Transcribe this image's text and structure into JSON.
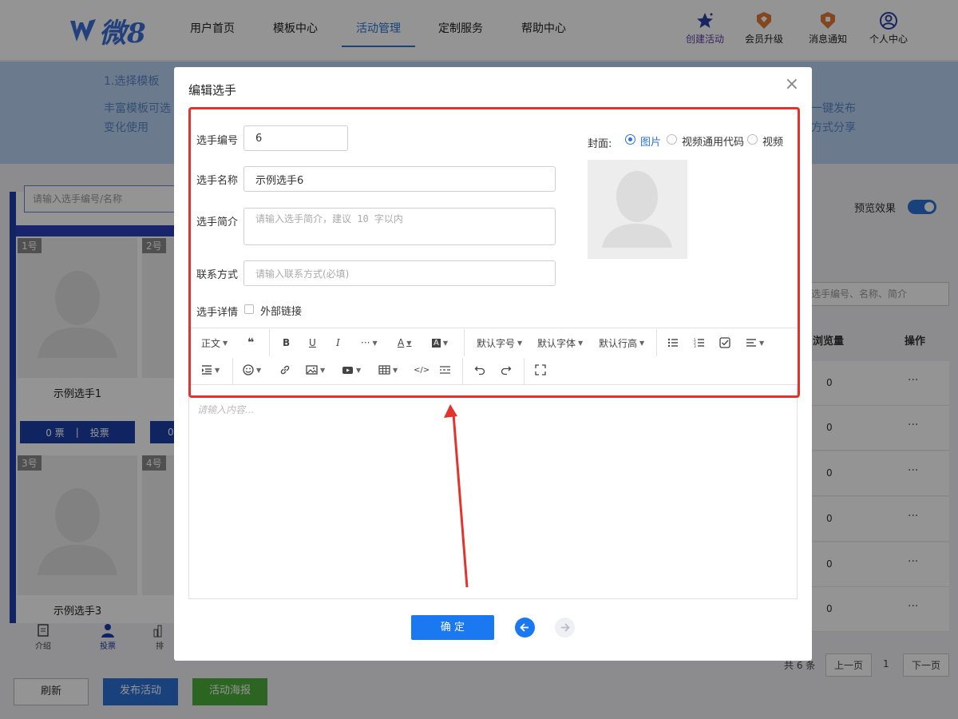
{
  "brand": {
    "logo_text": "微8"
  },
  "nav": {
    "items": [
      {
        "label": "用户首页"
      },
      {
        "label": "模板中心"
      },
      {
        "label": "活动管理"
      },
      {
        "label": "定制服务"
      },
      {
        "label": "帮助中心"
      }
    ],
    "active_index": 2,
    "right": [
      {
        "label": "创建活动",
        "icon": "star-icon"
      },
      {
        "label": "会员升级",
        "icon": "diamond-badge-icon"
      },
      {
        "label": "消息通知",
        "icon": "bell-badge-icon"
      },
      {
        "label": "个人中心",
        "icon": "user-circle-icon"
      }
    ]
  },
  "banner": {
    "left_title": "1.选择模板",
    "left_line1": "丰富模板可选",
    "left_line2": "变化使用",
    "right_line1": "一键发布",
    "right_line2": "方式分享"
  },
  "background": {
    "search_placeholder": "请输入选手编号/名称",
    "players": [
      {
        "no": "1号",
        "name": "示例选手1"
      },
      {
        "no": "2号",
        "name": ""
      },
      {
        "no": "3号",
        "name": "示例选手3"
      },
      {
        "no": "4号",
        "name": ""
      }
    ],
    "vote": {
      "votes": "0 票",
      "action": "投票",
      "partial": "0"
    },
    "tabs": [
      {
        "label": "介绍",
        "icon": "document-icon"
      },
      {
        "label": "投票",
        "icon": "user-icon"
      },
      {
        "label": "排",
        "icon": "bar-chart-icon"
      }
    ],
    "preview_label": "预览效果",
    "right_search_placeholder": "选手编号、名称、简介",
    "table_headers": {
      "views": "浏览量",
      "ops": "操作"
    },
    "rows": [
      {
        "views": "0",
        "ops": "···"
      },
      {
        "views": "0",
        "ops": "···"
      },
      {
        "views": "0",
        "ops": "···"
      },
      {
        "views": "0",
        "ops": "···"
      },
      {
        "views": "0",
        "ops": "···"
      },
      {
        "views": "0",
        "ops": "···"
      }
    ],
    "pager": {
      "total": "共 6 条",
      "prev": "上一页",
      "page": "1",
      "next": "下一页"
    },
    "footer": {
      "refresh": "刷新",
      "publish": "发布活动",
      "poster": "活动海报"
    }
  },
  "modal": {
    "title": "编辑选手",
    "close": "×",
    "fields": {
      "number_label": "选手编号",
      "number_value": "6",
      "name_label": "选手名称",
      "name_value": "示例选手6",
      "intro_label": "选手简介",
      "intro_placeholder": "请输入选手简介，建议 10 字以内",
      "contact_label": "联系方式",
      "contact_placeholder": "请输入联系方式(必填)",
      "detail_label": "选手详情",
      "external_link_label": "外部链接"
    },
    "cover": {
      "label": "封面:",
      "options": [
        "图片",
        "视频通用代码",
        "视频"
      ],
      "selected": "图片"
    },
    "toolbar": {
      "paragraph": "正文",
      "quote": "❝",
      "bold": "B",
      "underline": "U",
      "italic": "I",
      "more": "···",
      "font_color": "A",
      "bg_color": "A",
      "font_size": "默认字号",
      "font_family": "默认字体",
      "line_height": "默认行高"
    },
    "editor_placeholder": "请输入内容...",
    "confirm": "确 定"
  },
  "colors": {
    "accent": "#1a78f0",
    "brand_blue": "#2b73d6",
    "highlight_red": "#e5322d",
    "dark_blue": "#1d3fa8",
    "green": "#4caf3a"
  }
}
